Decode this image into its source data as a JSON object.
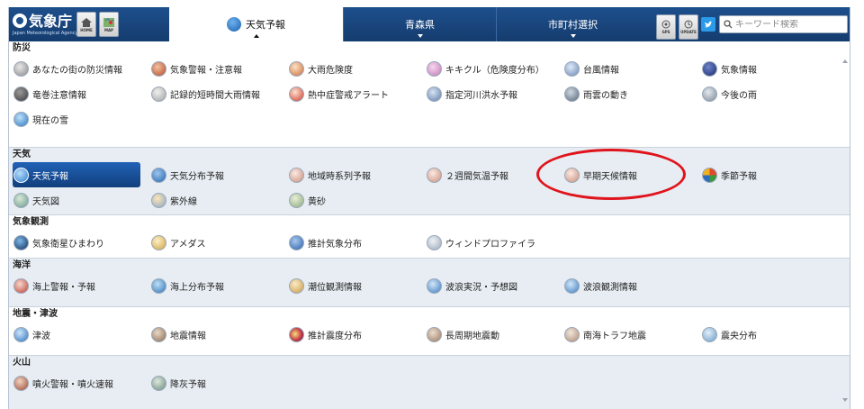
{
  "header": {
    "logo_text": "気象庁",
    "logo_sub": "Japan Meteorological Agency",
    "home_label": "HOME",
    "map_label": "MAP",
    "tabs": [
      {
        "label": "天気予報",
        "active": true
      },
      {
        "label": "青森県",
        "active": false
      },
      {
        "label": "市町村選択",
        "active": false
      }
    ],
    "gps_label": "GPS",
    "update_label": "UPDATE",
    "search_placeholder": "キーワード検索"
  },
  "sections": [
    {
      "title": "防災",
      "items": [
        "あなたの街の防災情報",
        "気象警報・注意報",
        "大雨危険度",
        "キキクル（危険度分布）",
        "台風情報",
        "気象情報",
        "竜巻注意情報",
        "記録的短時間大雨情報",
        "熱中症警戒アラート",
        "指定河川洪水予報",
        "雨雲の動き",
        "今後の雨",
        "現在の雪"
      ]
    },
    {
      "title": "天気",
      "items": [
        "天気予報",
        "天気分布予報",
        "地域時系列予報",
        "２週間気温予報",
        "早期天候情報",
        "季節予報",
        "天気図",
        "紫外線",
        "黄砂"
      ]
    },
    {
      "title": "気象観測",
      "items": [
        "気象衛星ひまわり",
        "アメダス",
        "推計気象分布",
        "ウィンドプロファイラ"
      ]
    },
    {
      "title": "海洋",
      "items": [
        "海上警報・予報",
        "海上分布予報",
        "潮位観測情報",
        "波浪実況・予想図",
        "波浪観測情報"
      ]
    },
    {
      "title": "地震・津波",
      "items": [
        "津波",
        "地震情報",
        "推計震度分布",
        "長周期地震動",
        "南海トラフ地震",
        "震央分布"
      ]
    },
    {
      "title": "火山",
      "items": [
        "噴火警報・噴火速報",
        "降灰予報"
      ]
    }
  ],
  "selected_item": "天気予報",
  "highlighted_item": "早期天候情報",
  "colors": {
    "header": "#1d4f8c",
    "accent": "#2062b6",
    "annotation": "#e0141c",
    "alt_section": "#e7edf3"
  }
}
